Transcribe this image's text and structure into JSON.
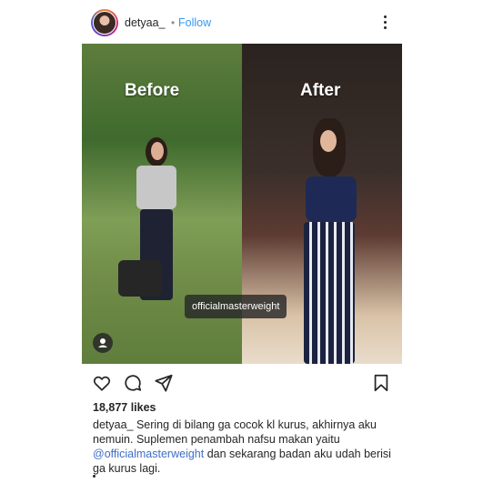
{
  "header": {
    "username": "detyaa_",
    "separator": "•",
    "follow_label": "Follow",
    "more_icon": "more-vertical-icon"
  },
  "image": {
    "label_before": "Before",
    "label_after": "After",
    "tag_text": "officialmasterweight",
    "user_tag_icon": "user-tag-icon"
  },
  "actions": {
    "like_icon": "heart-icon",
    "comment_icon": "comment-icon",
    "share_icon": "share-icon",
    "save_icon": "bookmark-icon"
  },
  "likes": "18,877 likes",
  "caption": {
    "username": "detyaa_",
    "text_1": " Sering di bilang ga cocok kl kurus, akhirnya aku nemuin. Suplemen penambah nafsu makan yaitu ",
    "mention": "@officialmasterweight",
    "text_2": " dan sekarang badan aku udah berisi ga kurus lagi."
  },
  "colors": {
    "link_blue": "#3897f0",
    "mention_blue": "#3f6ec6",
    "text": "#262626"
  }
}
